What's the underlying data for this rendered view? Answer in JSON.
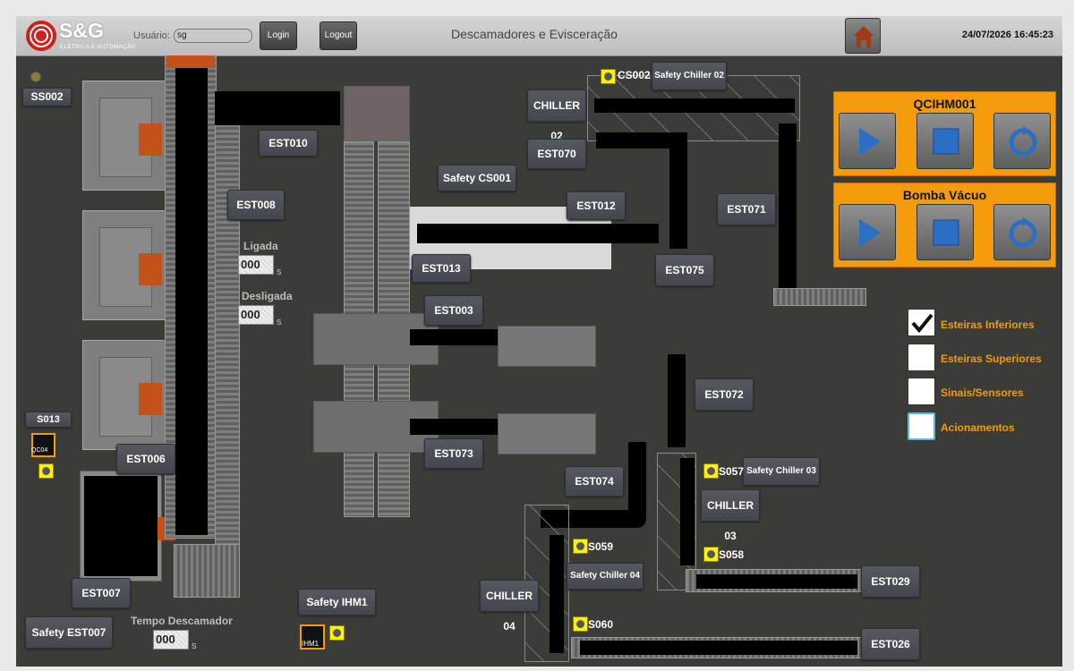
{
  "header": {
    "brand": "S&G",
    "brand_sub": "ELÉTRICA E AUTOMAÇÃO",
    "user_label": "Usuário:",
    "user_value": "sg",
    "login_label": "Login",
    "logout_label": "Logout",
    "title": "Descamadores e Evisceração",
    "datetime": "24/07/2026 16:45:23",
    "home_icon": "home-icon"
  },
  "labels": {
    "ss002": "SS002",
    "est010": "EST010",
    "est008": "EST008",
    "est006": "EST006",
    "est007": "EST007",
    "safety_est007": "Safety EST007",
    "safety_ihm1": "Safety  IHM1",
    "safety_cs001": "Safety CS001",
    "est012": "EST012",
    "est013": "EST013",
    "est003": "EST003",
    "est073": "EST073",
    "est074": "EST074",
    "chiller02": "CHILLER 02",
    "est070": "EST070",
    "safety_chiller02": "Safety Chiller 02",
    "est071": "EST071",
    "est075": "EST075",
    "est072": "EST072",
    "safety_chiller03": "Safety Chiller 03",
    "chiller03": "CHILLER 03",
    "safety_chiller04": "Safety Chiller 04",
    "chiller04": "CHILLER 04",
    "est029": "EST029",
    "est026": "EST026",
    "s013": "S013",
    "qc04": "QC04",
    "ihm1": "IHM1"
  },
  "sensors": {
    "cs002": "CS002",
    "s057": "S057",
    "s058": "S058",
    "s059": "S059",
    "s060": "S060"
  },
  "timers": {
    "ligada_label": "Ligada",
    "ligada_value": "000",
    "desligada_label": "Desligada",
    "desligada_value": "000",
    "tempo_label": "Tempo Descamador",
    "tempo_value": "000",
    "unit": "s"
  },
  "controls": [
    {
      "title": "QCIHM001",
      "icons": [
        "play-icon",
        "stop-icon",
        "reset-icon"
      ]
    },
    {
      "title": "Bomba Vácuo",
      "icons": [
        "play-icon",
        "stop-icon",
        "reset-icon"
      ]
    }
  ],
  "layers": [
    {
      "label": "Esteiras Inferiores",
      "checked": true
    },
    {
      "label": "Esteiras Superiores",
      "checked": false
    },
    {
      "label": "Sinais/Sensores",
      "checked": false
    },
    {
      "label": "Acionamentos",
      "checked": false
    }
  ],
  "colors": {
    "accent": "#f39b0a",
    "sensor": "#fff200",
    "chute": "#c3521a",
    "background": "#3b3c38"
  }
}
